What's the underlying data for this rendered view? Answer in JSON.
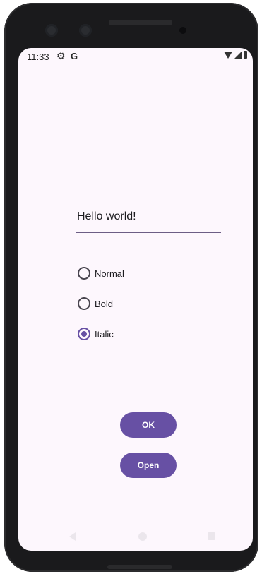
{
  "status_bar": {
    "time": "11:33",
    "g_label": "G",
    "icons": [
      "gear-icon",
      "google-icon",
      "wifi-icon",
      "signal-icon",
      "battery-icon"
    ]
  },
  "text_field": {
    "value": "Hello world!"
  },
  "radio_group": {
    "options": [
      {
        "label": "Normal",
        "checked": false
      },
      {
        "label": "Bold",
        "checked": false
      },
      {
        "label": "Italic",
        "checked": true
      }
    ]
  },
  "buttons": {
    "ok_label": "OK",
    "open_label": "Open"
  },
  "nav_bar": {
    "icons": [
      "back-icon",
      "home-icon",
      "recents-icon"
    ]
  },
  "colors": {
    "accent": "#6750a4",
    "background": "#fdf7fd",
    "underline": "#6c5e85",
    "text": "#1c1b1f"
  }
}
